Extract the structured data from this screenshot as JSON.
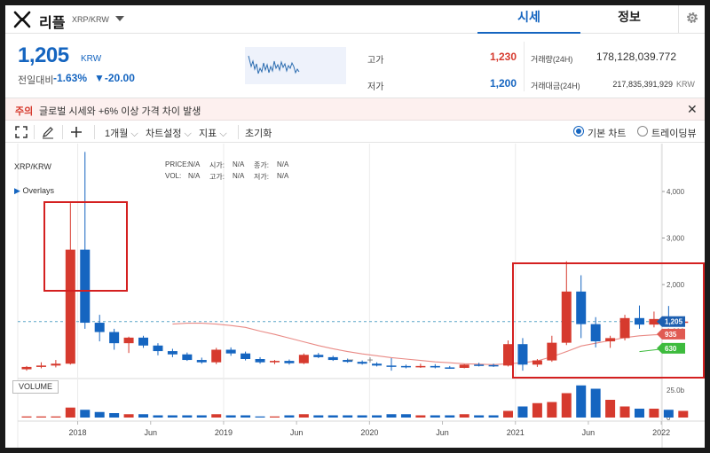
{
  "header": {
    "coin_name": "리플",
    "pair": "XRP/KRW",
    "tabs": [
      {
        "label": "시세",
        "active": true
      },
      {
        "label": "정보",
        "active": false
      }
    ]
  },
  "summary": {
    "price": "1,205",
    "unit": "KRW",
    "change_label": "전일대비",
    "change_pct": "-1.63%",
    "change_abs": "▼-20.00",
    "high_label": "고가",
    "high_value": "1,230",
    "low_label": "저가",
    "low_value": "1,200",
    "volume_label": "거래량(24H)",
    "volume_value": "178,128,039.772",
    "amount_label": "거래대금(24H)",
    "amount_value": "217,835,391,929",
    "amount_unit": "KRW"
  },
  "notice": {
    "tag": "주의",
    "message": "글로벌 시세와 +6% 이상 가격 차이 발생"
  },
  "toolbar": {
    "period": "1개월",
    "chart_settings": "차트설정",
    "indicators": "지표",
    "reset": "초기화",
    "basic_chart": "기본 차트",
    "trading_view": "트레이딩뷰"
  },
  "chart_panel": {
    "pair": "XRP/KRW",
    "overlays": "Overlays",
    "ohlc_labels": {
      "price": "PRICE:",
      "open": "시가:",
      "close": "종가:",
      "vol": "VOL:",
      "high": "고가:",
      "low": "저가:"
    },
    "na": "N/A",
    "volume_button": "VOLUME",
    "zoom_minus": "−",
    "zoom_plus": "+"
  },
  "colors": {
    "up": "#d63a2e",
    "down": "#1565c0",
    "ma": "#e98a85",
    "ma2": "#3dbb3d",
    "accent": "#1565c0"
  },
  "chart_data": {
    "type": "candlestick",
    "y_ticks": [
      1000,
      2000,
      3000,
      4000
    ],
    "y_tick_labels": [
      "1,000",
      "2,000",
      "3,000",
      "4,000"
    ],
    "ylim": [
      0,
      4800
    ],
    "x_ticks": [
      {
        "label": "2018",
        "pos": 4
      },
      {
        "label": "Jun",
        "pos": 9
      },
      {
        "label": "2019",
        "pos": 14
      },
      {
        "label": "Jun",
        "pos": 19
      },
      {
        "label": "2020",
        "pos": 24
      },
      {
        "label": "Jun",
        "pos": 29
      },
      {
        "label": "2021",
        "pos": 34
      },
      {
        "label": "Jun",
        "pos": 39
      },
      {
        "label": "2022",
        "pos": 44
      }
    ],
    "volume_ticks": [
      "25.0b",
      "0"
    ],
    "volume_max": 32,
    "current_price": 1205,
    "current_price_label": "1,205",
    "ma_labels": [
      {
        "label": "935",
        "value": 935,
        "color": "#e05a52"
      },
      {
        "label": "630",
        "value": 630,
        "color": "#3dbb3d"
      }
    ],
    "candles": [
      {
        "o": 180,
        "h": 250,
        "l": 150,
        "c": 230
      },
      {
        "o": 230,
        "h": 330,
        "l": 200,
        "c": 260
      },
      {
        "o": 260,
        "h": 380,
        "l": 220,
        "c": 300
      },
      {
        "o": 300,
        "h": 3750,
        "l": 280,
        "c": 2750
      },
      {
        "o": 2750,
        "h": 4850,
        "l": 1050,
        "c": 1180
      },
      {
        "o": 1180,
        "h": 1350,
        "l": 780,
        "c": 980
      },
      {
        "o": 980,
        "h": 1050,
        "l": 600,
        "c": 740
      },
      {
        "o": 740,
        "h": 880,
        "l": 530,
        "c": 860
      },
      {
        "o": 860,
        "h": 900,
        "l": 640,
        "c": 690
      },
      {
        "o": 690,
        "h": 740,
        "l": 480,
        "c": 570
      },
      {
        "o": 570,
        "h": 620,
        "l": 440,
        "c": 500
      },
      {
        "o": 500,
        "h": 540,
        "l": 360,
        "c": 380
      },
      {
        "o": 380,
        "h": 430,
        "l": 300,
        "c": 330
      },
      {
        "o": 330,
        "h": 640,
        "l": 290,
        "c": 600
      },
      {
        "o": 600,
        "h": 650,
        "l": 470,
        "c": 520
      },
      {
        "o": 520,
        "h": 560,
        "l": 370,
        "c": 400
      },
      {
        "o": 400,
        "h": 440,
        "l": 300,
        "c": 330
      },
      {
        "o": 330,
        "h": 380,
        "l": 290,
        "c": 360
      },
      {
        "o": 360,
        "h": 390,
        "l": 280,
        "c": 310
      },
      {
        "o": 310,
        "h": 520,
        "l": 290,
        "c": 490
      },
      {
        "o": 490,
        "h": 530,
        "l": 420,
        "c": 440
      },
      {
        "o": 440,
        "h": 470,
        "l": 360,
        "c": 380
      },
      {
        "o": 380,
        "h": 410,
        "l": 320,
        "c": 340
      },
      {
        "o": 340,
        "h": 370,
        "l": 280,
        "c": 300
      },
      {
        "o": 300,
        "h": 330,
        "l": 240,
        "c": 260
      },
      {
        "o": 260,
        "h": 420,
        "l": 150,
        "c": 250
      },
      {
        "o": 250,
        "h": 280,
        "l": 200,
        "c": 230
      },
      {
        "o": 230,
        "h": 300,
        "l": 210,
        "c": 250
      },
      {
        "o": 250,
        "h": 290,
        "l": 200,
        "c": 220
      },
      {
        "o": 220,
        "h": 250,
        "l": 190,
        "c": 210
      },
      {
        "o": 210,
        "h": 290,
        "l": 200,
        "c": 280
      },
      {
        "o": 280,
        "h": 320,
        "l": 240,
        "c": 270
      },
      {
        "o": 270,
        "h": 300,
        "l": 230,
        "c": 260
      },
      {
        "o": 260,
        "h": 800,
        "l": 240,
        "c": 720
      },
      {
        "o": 720,
        "h": 850,
        "l": 150,
        "c": 280
      },
      {
        "o": 280,
        "h": 400,
        "l": 230,
        "c": 370
      },
      {
        "o": 370,
        "h": 900,
        "l": 340,
        "c": 750
      },
      {
        "o": 750,
        "h": 2500,
        "l": 700,
        "c": 1850
      },
      {
        "o": 1850,
        "h": 2200,
        "l": 850,
        "c": 1150
      },
      {
        "o": 1150,
        "h": 1300,
        "l": 650,
        "c": 780
      },
      {
        "o": 780,
        "h": 900,
        "l": 640,
        "c": 850
      },
      {
        "o": 850,
        "h": 1350,
        "l": 800,
        "c": 1280
      },
      {
        "o": 1280,
        "h": 1550,
        "l": 1050,
        "c": 1140
      },
      {
        "o": 1140,
        "h": 1420,
        "l": 1080,
        "c": 1260
      },
      {
        "o": 1260,
        "h": 1540,
        "l": 1120,
        "c": 1190
      },
      {
        "o": 1190,
        "h": 1240,
        "l": 1160,
        "c": 1205
      }
    ],
    "volumes": [
      1,
      1,
      1,
      9,
      7,
      5,
      4,
      3,
      3,
      2,
      2,
      2,
      2,
      3,
      2,
      2,
      1,
      1,
      2,
      3,
      2,
      2,
      2,
      2,
      2,
      3,
      3,
      2,
      2,
      2,
      3,
      2,
      2,
      6,
      10,
      13,
      14,
      22,
      29,
      26,
      16,
      10,
      8,
      8,
      7,
      6
    ],
    "ma_line": [
      null,
      null,
      null,
      null,
      null,
      null,
      null,
      null,
      null,
      null,
      1150,
      1170,
      1170,
      1150,
      1120,
      1080,
      1000,
      930,
      850,
      770,
      690,
      620,
      560,
      510,
      470,
      430,
      400,
      370,
      340,
      320,
      300,
      290,
      280,
      300,
      320,
      360,
      450,
      560,
      680,
      740,
      800,
      860,
      900,
      920,
      930,
      935
    ]
  }
}
